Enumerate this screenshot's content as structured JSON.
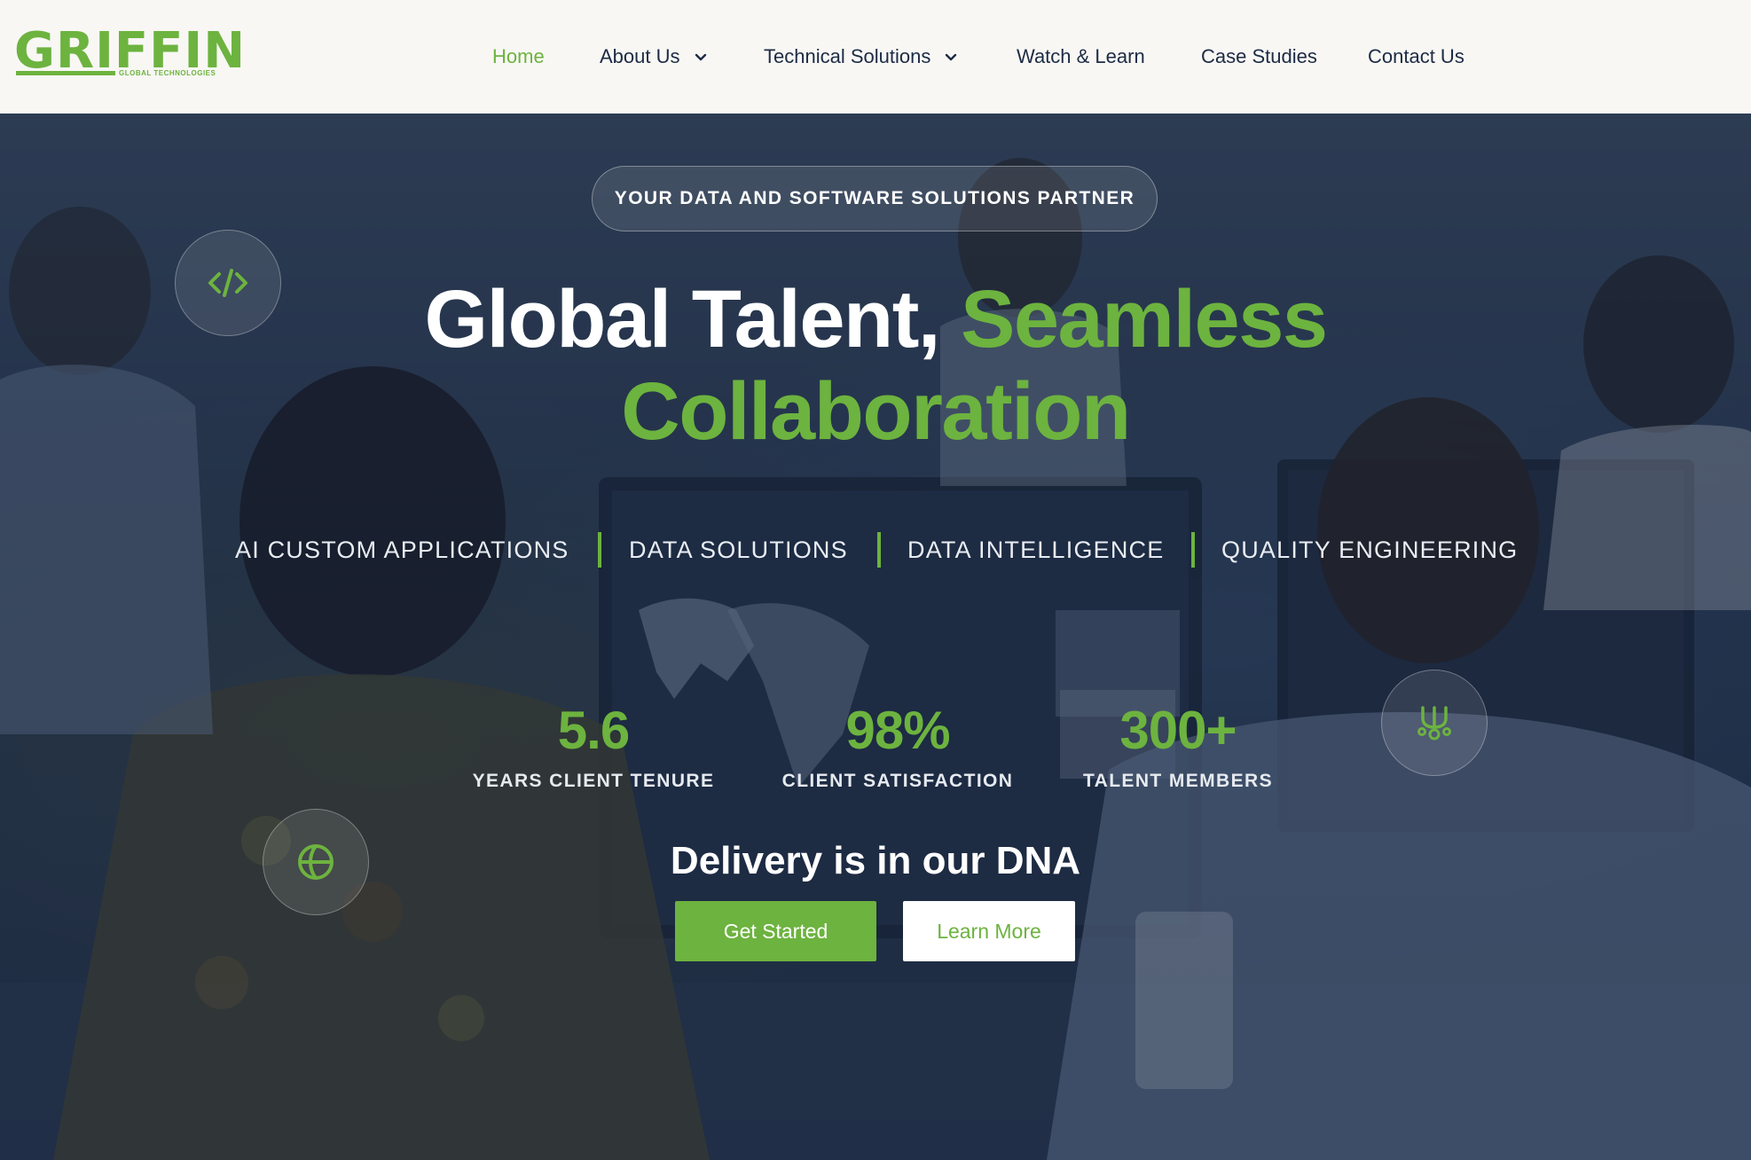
{
  "brand": {
    "name": "GRIFFIN",
    "subtitle": "GLOBAL TECHNOLOGIES",
    "accent_color": "#6db33f",
    "text_color": "#1d2b44"
  },
  "nav": {
    "items": [
      {
        "label": "Home",
        "active": true
      },
      {
        "label": "About Us",
        "dropdown": true
      },
      {
        "label": "Technical Solutions",
        "dropdown": true
      },
      {
        "label": "Watch & Learn"
      },
      {
        "label": "Case Studies"
      },
      {
        "label": "Contact Us"
      }
    ]
  },
  "hero": {
    "eyebrow": "YOUR DATA AND SOFTWARE SOLUTIONS PARTNER",
    "headline_part1": "Global Talent,",
    "headline_part2": "Seamless",
    "headline_part3": "Collaboration",
    "services": [
      "AI CUSTOM APPLICATIONS",
      "DATA SOLUTIONS",
      "DATA INTELLIGENCE",
      "QUALITY ENGINEERING"
    ],
    "stats": [
      {
        "value": "5.6",
        "label": "YEARS CLIENT TENURE"
      },
      {
        "value": "98%",
        "label": "CLIENT SATISFACTION"
      },
      {
        "value": "300+",
        "label": "TALENT MEMBERS"
      }
    ],
    "tagline": "Delivery is in our DNA",
    "primary_cta": "Get Started",
    "secondary_cta": "Learn More",
    "floating_icons": [
      "code-icon",
      "molecule-icon",
      "globe-icon"
    ]
  }
}
